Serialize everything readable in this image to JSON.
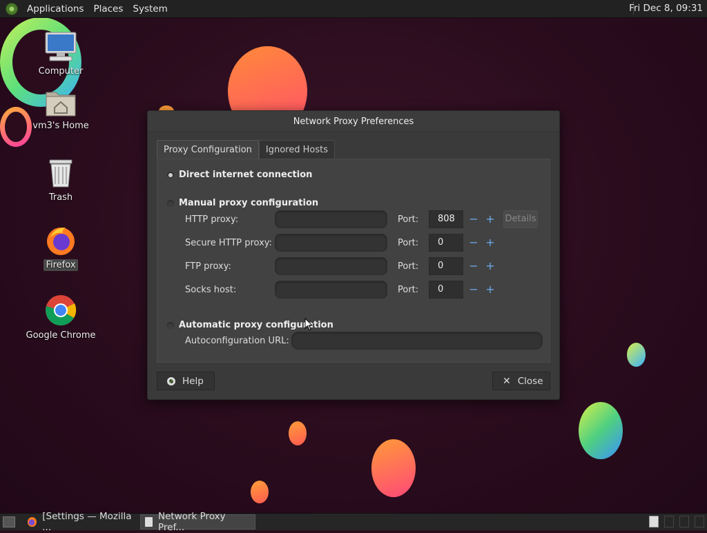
{
  "top_panel": {
    "menus": [
      "Applications",
      "Places",
      "System"
    ],
    "clock": "Fri Dec 8, 09:31"
  },
  "desktop": {
    "icons": [
      {
        "label": "Computer",
        "icon": "computer-icon"
      },
      {
        "label": "vm3's Home",
        "icon": "home-folder-icon"
      },
      {
        "label": "Trash",
        "icon": "trash-icon"
      },
      {
        "label": "Firefox",
        "icon": "firefox-icon",
        "selected": true
      },
      {
        "label": "Google Chrome",
        "icon": "chrome-icon"
      }
    ]
  },
  "dialog": {
    "title": "Network Proxy Preferences",
    "tabs": [
      {
        "label": "Proxy Configuration",
        "active": true
      },
      {
        "label": "Ignored Hosts",
        "active": false
      }
    ],
    "options": {
      "direct": {
        "label": "Direct internet connection",
        "selected": true
      },
      "manual": {
        "label": "Manual proxy configuration",
        "selected": false
      },
      "automatic": {
        "label": "Automatic proxy configuration",
        "selected": false
      }
    },
    "proxies": [
      {
        "label": "HTTP proxy:",
        "host": "",
        "port_label": "Port:",
        "port": "808",
        "has_details": true
      },
      {
        "label": "Secure HTTP proxy:",
        "host": "",
        "port_label": "Port:",
        "port": "0",
        "has_details": false
      },
      {
        "label": "FTP proxy:",
        "host": "",
        "port_label": "Port:",
        "port": "0",
        "has_details": false
      },
      {
        "label": "Socks host:",
        "host": "",
        "port_label": "Port:",
        "port": "0",
        "has_details": false
      }
    ],
    "details_label": "Details",
    "autoconfig": {
      "label": "Autoconfiguration URL:",
      "value": ""
    },
    "buttons": {
      "help": "Help",
      "close": "Close"
    }
  },
  "taskbar": {
    "tasks": [
      {
        "label": "[Settings — Mozilla ...",
        "icon": "firefox-icon",
        "active": false
      },
      {
        "label": "Network Proxy Pref...",
        "icon": "document-icon",
        "active": true
      }
    ]
  }
}
